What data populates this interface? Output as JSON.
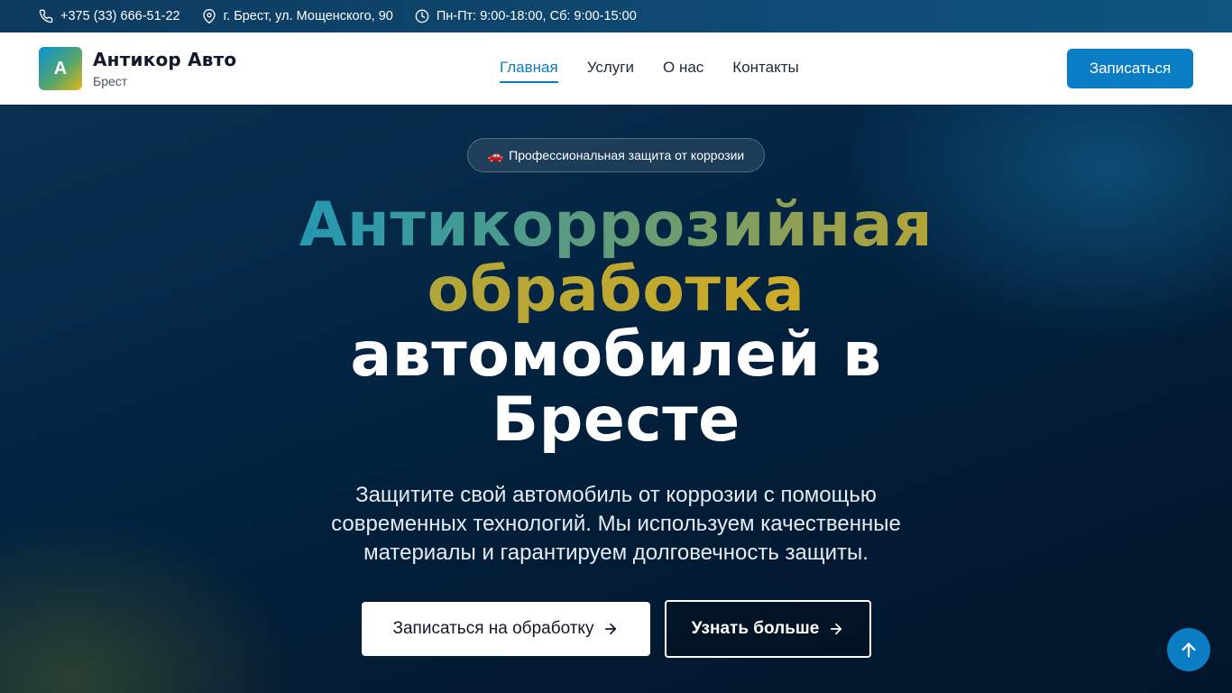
{
  "topbar": {
    "phone": "+375 (33) 666-51-22",
    "address": "г. Брест, ул. Мощенского, 90",
    "hours": "Пн-Пт: 9:00-18:00, Сб: 9:00-15:00"
  },
  "header": {
    "logo_letter": "А",
    "brand_name": "Антикор Авто",
    "brand_city": "Брест",
    "nav": [
      {
        "label": "Главная",
        "active": true
      },
      {
        "label": "Услуги",
        "active": false
      },
      {
        "label": "О нас",
        "active": false
      },
      {
        "label": "Контакты",
        "active": false
      }
    ],
    "cta_label": "Записаться"
  },
  "hero": {
    "badge_icon": "🚗",
    "badge_text": "Профессиональная защита от коррозии",
    "title_line1": "Антикоррозийная",
    "title_line2": "обработка",
    "title_line3": "автомобилей в",
    "title_line4": "Бресте",
    "subtitle": "Защитите свой автомобиль от коррозии с помощью современных технологий. Мы используем качественные материалы и гарантируем долговечность защиты.",
    "primary_button": "Записаться на обработку",
    "secondary_button": "Узнать больше"
  },
  "colors": {
    "accent": "#0a7dc4",
    "topbar": "#0f4a73",
    "hero_bg": "#032544",
    "gradient_start": "#0a8fd6",
    "gradient_end": "#e7b517"
  },
  "icons": {
    "phone": "phone-icon",
    "location": "map-pin-icon",
    "hours": "clock-icon",
    "arrow": "arrow-right-icon",
    "scroll_top": "arrow-up-icon"
  }
}
